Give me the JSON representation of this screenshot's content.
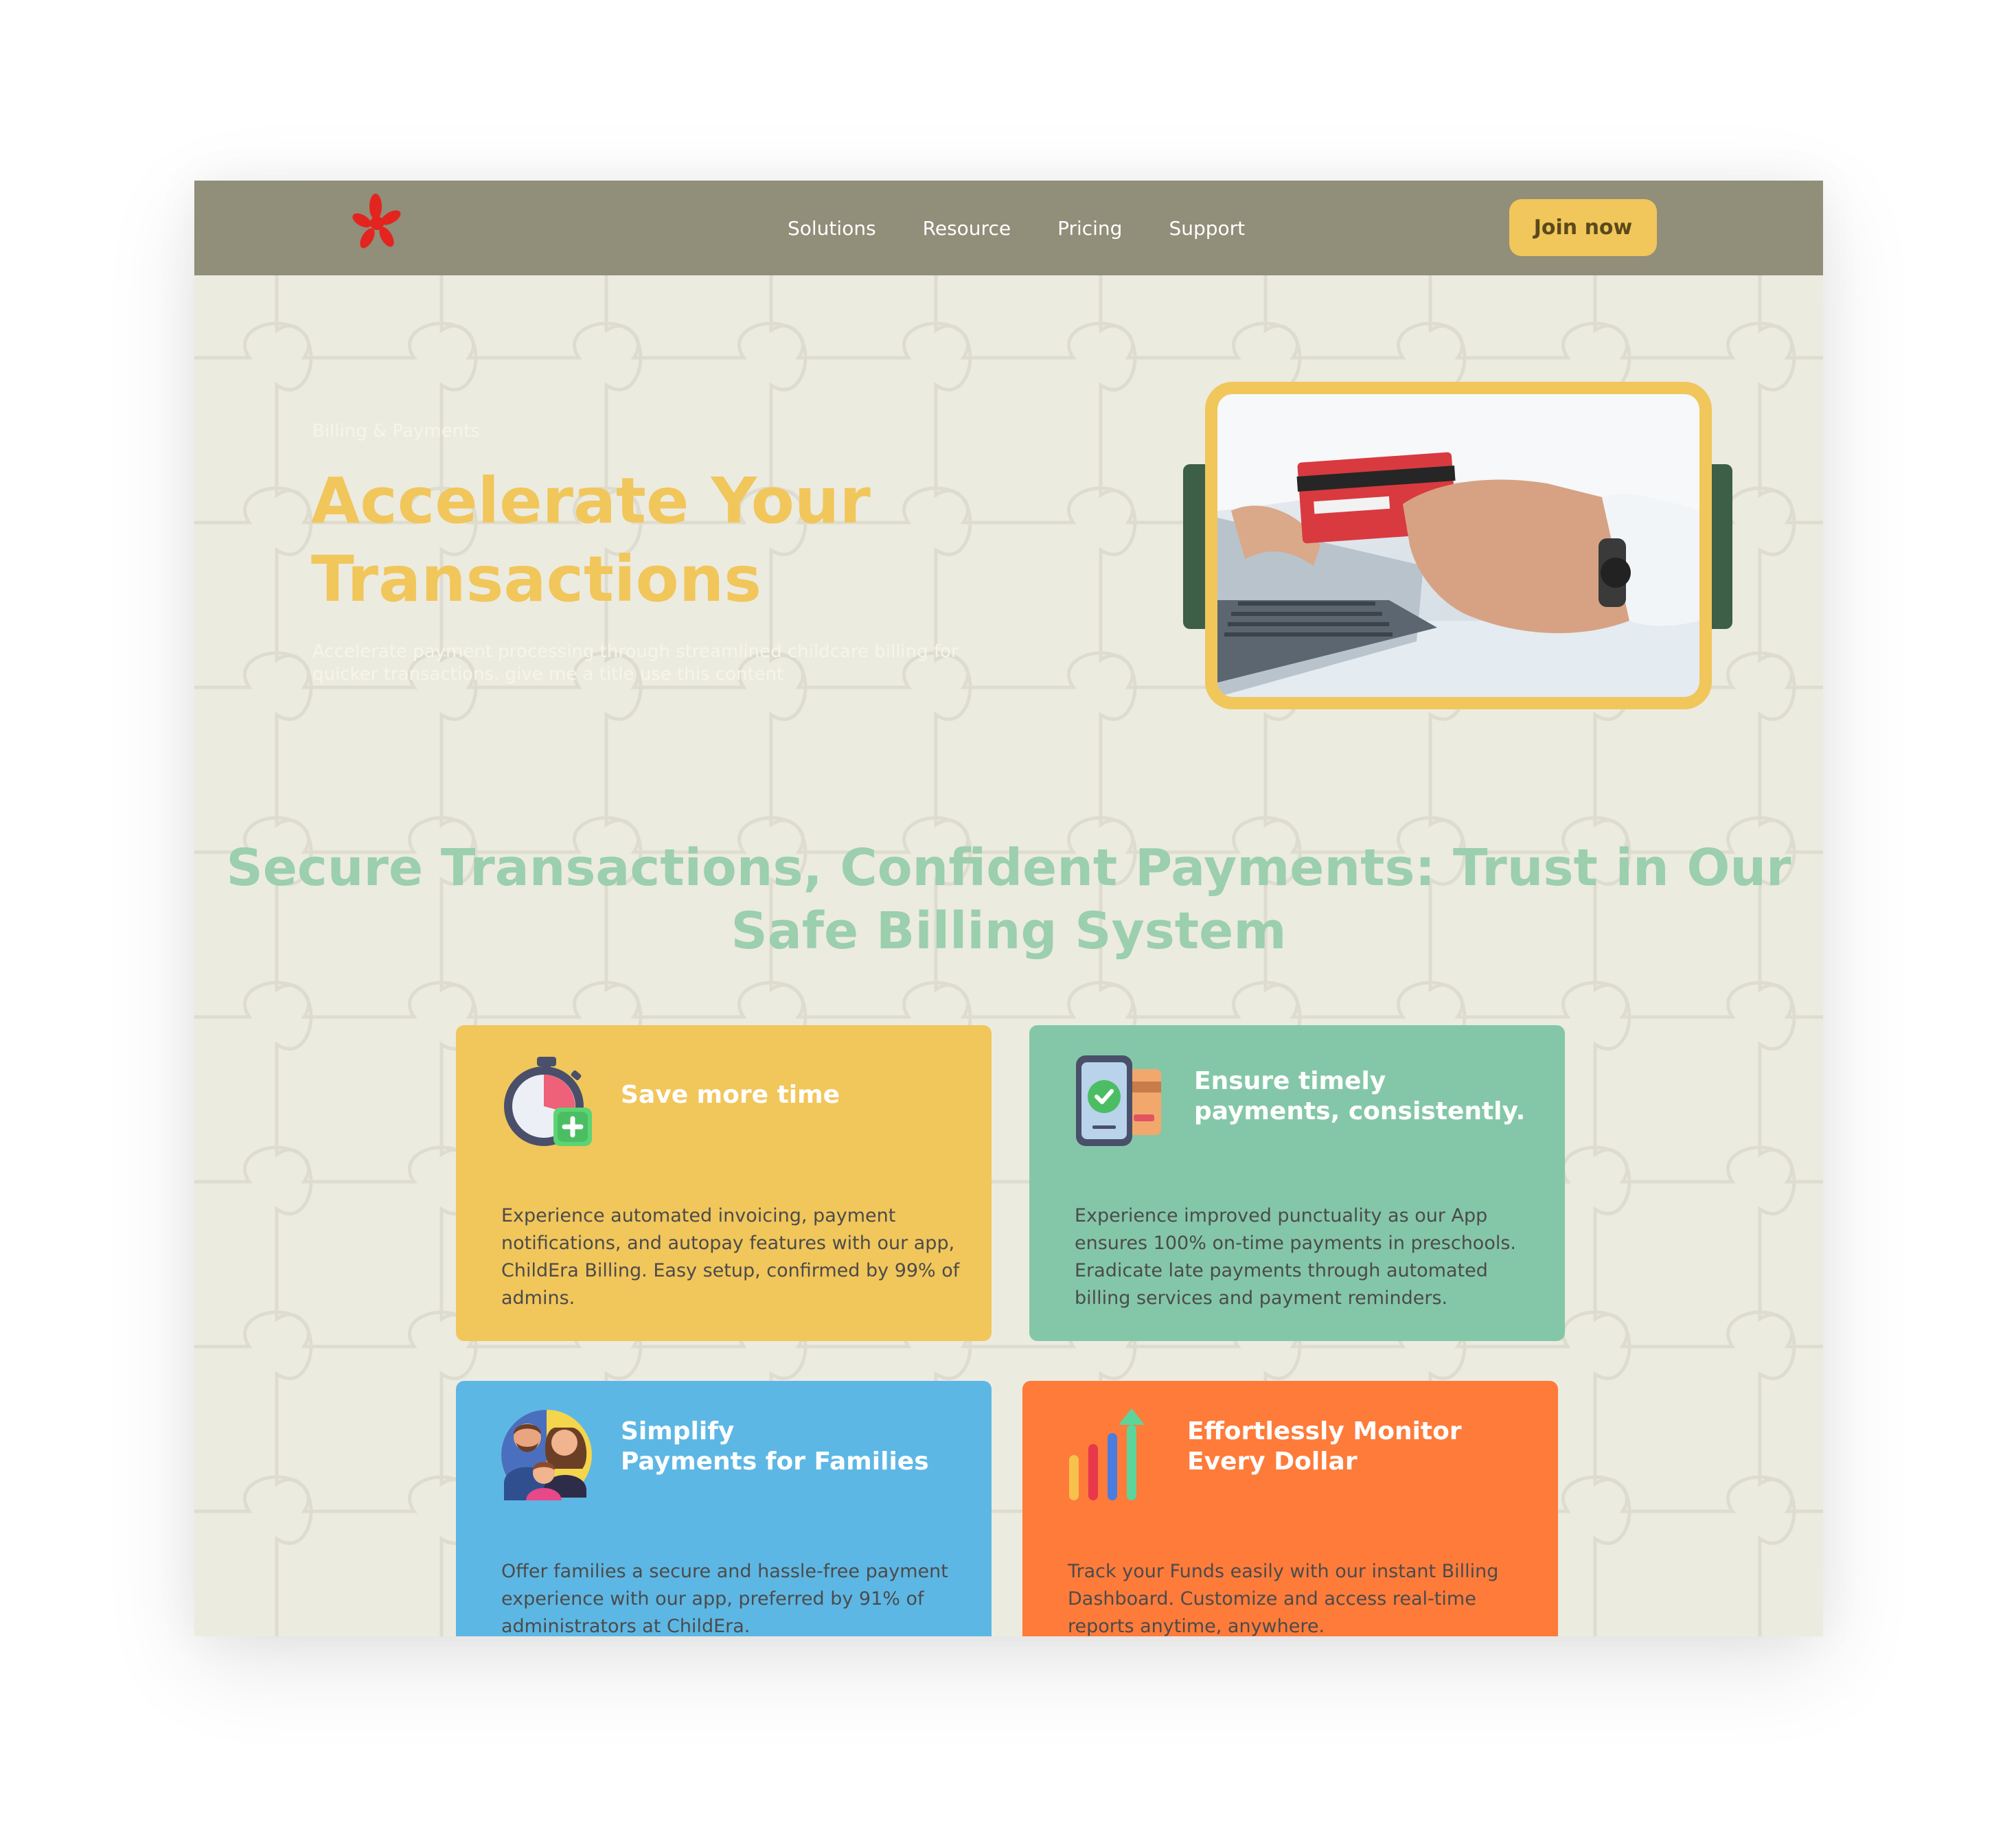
{
  "nav": {
    "links": [
      "Solutions",
      "Resource",
      "Pricing",
      "Support"
    ],
    "join_label": "Join now"
  },
  "hero": {
    "eyebrow": "Billing & Payments",
    "title": "Accelerate Your Transactions",
    "description": "Accelerate payment processing through streamlined childcare billing for quicker transactions. give me a title use this content"
  },
  "section": {
    "title": "Secure Transactions, Confident Payments: Trust in Our Safe Billing System"
  },
  "cards": [
    {
      "title": "Save more time",
      "body": "Experience automated invoicing, payment notifications, and autopay features with our app, ChildEra Billing. Easy setup, confirmed by 99% of admins.",
      "icon": "stopwatch-icon",
      "color": "#f1c65b"
    },
    {
      "title": "Ensure timely\npayments, consistently.",
      "body": "Experience improved punctuality as our App ensures 100% on-time payments in preschools. Eradicate late payments through automated billing services and payment reminders.",
      "icon": "phone-payment-icon",
      "color": "#84c7a8"
    },
    {
      "title": "Simplify\nPayments for Families",
      "body": "Offer families a secure and hassle-free payment experience with our app, preferred by 91% of administrators at ChildEra.",
      "icon": "family-icon",
      "color": "#5db7e4"
    },
    {
      "title": "Effortlessly Monitor\nEvery Dollar",
      "body": "Track your Funds easily with our instant Billing Dashboard. Customize and access real-time reports anytime, anywhere.",
      "icon": "growth-chart-icon",
      "color": "#fe7b3a"
    }
  ],
  "colors": {
    "nav_bg": "#918e79",
    "page_bg": "#ecebe0",
    "accent_yellow": "#f1c65b",
    "accent_green": "#84c7a8",
    "accent_blue": "#5db7e4",
    "accent_orange": "#fe7b3a",
    "section_title": "#9bcfae"
  }
}
